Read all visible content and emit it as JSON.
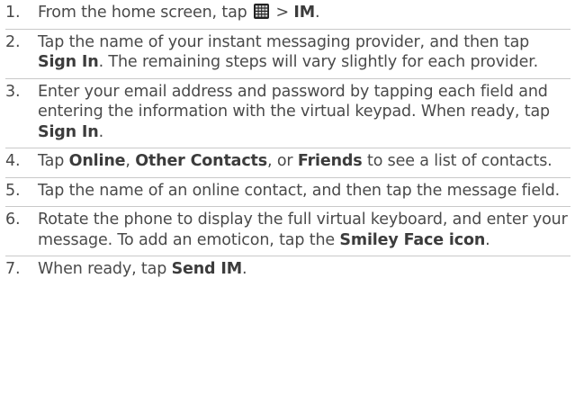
{
  "steps": [
    {
      "number": "1.",
      "parts": [
        "From the home screen, tap ",
        " > ",
        "IM",
        "."
      ],
      "icon": "apps-grid-icon"
    },
    {
      "number": "2.",
      "parts": [
        "Tap the name of your instant messaging provider, and then tap ",
        "Sign In",
        ". The remaining steps will vary slightly for each provider."
      ]
    },
    {
      "number": "3.",
      "parts": [
        "Enter your email address and password by tapping each field and entering the information with the virtual keypad. When ready, tap ",
        "Sign In",
        "."
      ]
    },
    {
      "number": "4.",
      "parts": [
        "Tap ",
        "Online",
        ", ",
        "Other Contacts",
        ", or ",
        "Friends",
        " to see a list of contacts."
      ]
    },
    {
      "number": "5.",
      "parts": [
        "Tap the name of an online contact, and then tap the message field."
      ]
    },
    {
      "number": "6.",
      "parts": [
        "Rotate the phone to display the full virtual keyboard, and enter your message. To add an emoticon, tap the ",
        "Smiley Face icon",
        "."
      ]
    },
    {
      "number": "7.",
      "parts": [
        "When ready, tap ",
        "Send IM",
        "."
      ]
    }
  ],
  "colors": {
    "text": "#4a4a4a",
    "divider": "#c9c9c9",
    "icon_bg": "#222222"
  }
}
